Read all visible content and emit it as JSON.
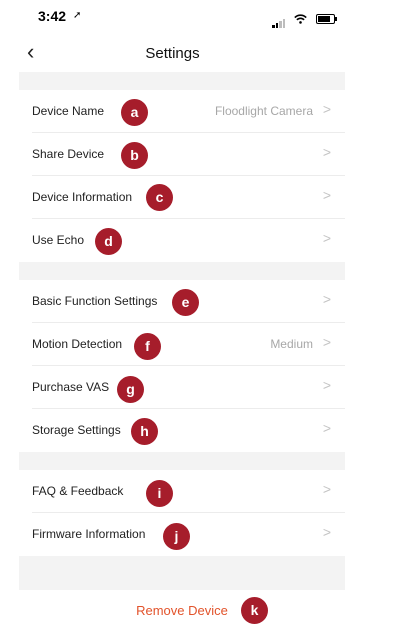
{
  "status_bar": {
    "time": "3:42",
    "location_glyph": "➚"
  },
  "nav": {
    "back_glyph": "‹",
    "title": "Settings"
  },
  "sections": [
    {
      "items": [
        {
          "label": "Device Name",
          "value": "Floodlight Camera",
          "callout": "a"
        },
        {
          "label": "Share Device",
          "value": "",
          "callout": "b"
        },
        {
          "label": "Device Information",
          "value": "",
          "callout": "c"
        },
        {
          "label": "Use Echo",
          "value": "",
          "callout": "d"
        }
      ]
    },
    {
      "items": [
        {
          "label": "Basic Function Settings",
          "value": "",
          "callout": "e"
        },
        {
          "label": "Motion Detection",
          "value": "Medium",
          "callout": "f"
        },
        {
          "label": "Purchase VAS",
          "value": "",
          "callout": "g"
        },
        {
          "label": "Storage Settings",
          "value": "",
          "callout": "h"
        }
      ]
    },
    {
      "items": [
        {
          "label": "FAQ & Feedback",
          "value": "",
          "callout": "i"
        },
        {
          "label": "Firmware Information",
          "value": "",
          "callout": "j"
        }
      ]
    }
  ],
  "remove": {
    "label": "Remove Device",
    "callout": "k"
  },
  "chevron_glyph": ">",
  "colors": {
    "callout_badge": "#a61d2b",
    "remove_text": "#e2532b",
    "section_gap": "#f3f3f3"
  }
}
